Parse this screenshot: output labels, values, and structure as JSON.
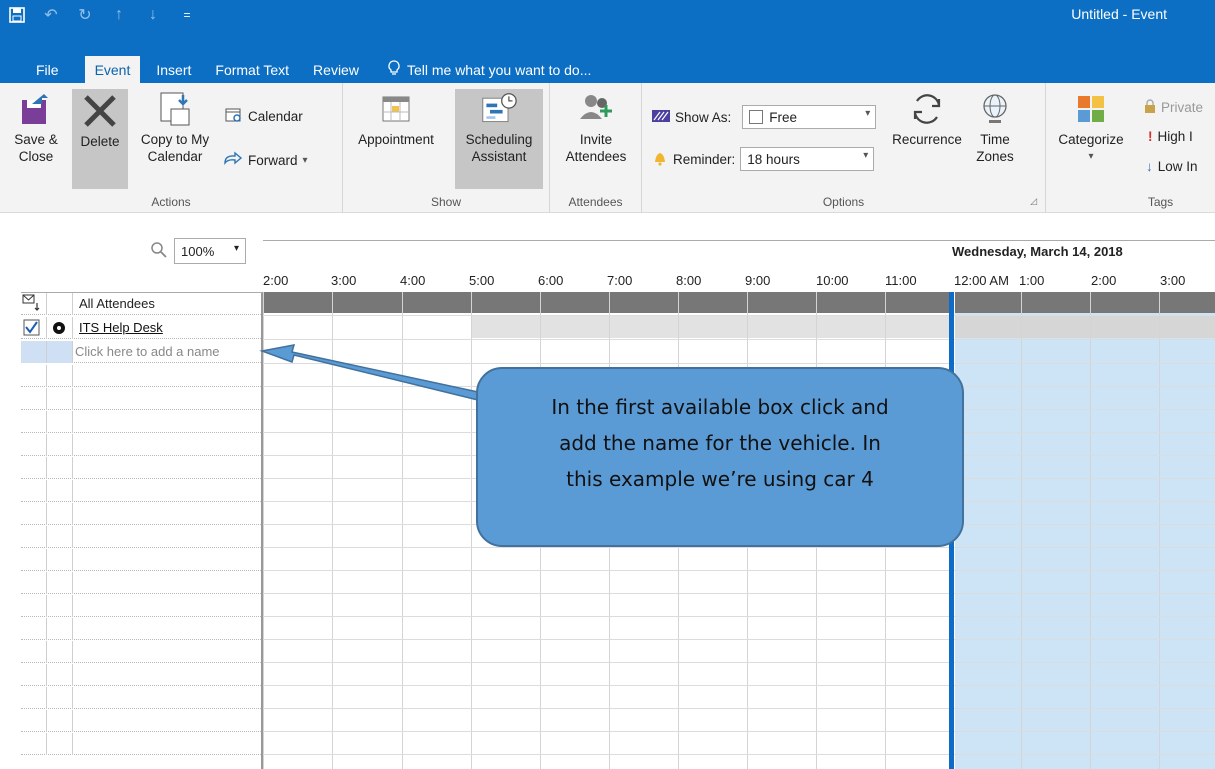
{
  "window": {
    "title": "Untitled - Event"
  },
  "qat": [
    {
      "icon": "save-icon",
      "glyph": "🖫"
    },
    {
      "icon": "undo-icon",
      "glyph": "↶"
    },
    {
      "icon": "redo-icon",
      "glyph": "↻"
    },
    {
      "icon": "up-arrow-icon",
      "glyph": "↑"
    },
    {
      "icon": "down-arrow-icon",
      "glyph": "↓"
    },
    {
      "icon": "customize-qat-icon",
      "glyph": "⩡"
    }
  ],
  "tabs": {
    "file": "File",
    "event": "Event",
    "insert": "Insert",
    "format_text": "Format Text",
    "review": "Review",
    "tell_me": "Tell me what you want to do..."
  },
  "ribbon": {
    "actions": {
      "label": "Actions",
      "save_close_1": "Save &",
      "save_close_2": "Close",
      "delete": "Delete",
      "copy_1": "Copy to My",
      "copy_2": "Calendar",
      "calendar": "Calendar",
      "forward": "Forward"
    },
    "show": {
      "label": "Show",
      "appointment": "Appointment",
      "scheduling_1": "Scheduling",
      "scheduling_2": "Assistant"
    },
    "attendees": {
      "label": "Attendees",
      "invite_1": "Invite",
      "invite_2": "Attendees"
    },
    "options": {
      "label": "Options",
      "show_as_label": "Show As:",
      "show_as_value": "Free",
      "reminder_label": "Reminder:",
      "reminder_value": "18 hours",
      "recurrence": "Recurrence",
      "time_zones_1": "Time",
      "time_zones_2": "Zones"
    },
    "tags": {
      "label": "Tags",
      "categorize": "Categorize",
      "private": "Private",
      "high": "High I",
      "low": "Low In"
    }
  },
  "scheduler": {
    "zoom": "100%",
    "day_title": "Wednesday, March 14, 2018",
    "times": [
      "2:00",
      "3:00",
      "4:00",
      "5:00",
      "6:00",
      "7:00",
      "8:00",
      "9:00",
      "10:00",
      "11:00",
      "12:00 AM",
      "1:00",
      "2:00",
      "3:00"
    ],
    "rows": {
      "all_attendees": "All Attendees",
      "attendee_1": "ITS Help Desk",
      "add_placeholder": "Click here to add a name"
    }
  },
  "callout": {
    "line1": "In the first available box click and",
    "line2": "add the name for the vehicle. In",
    "line3": "this example we’re using car 4"
  },
  "colors": {
    "accent": "#0c6fc4",
    "callout_fill": "#5b9bd5",
    "callout_border": "#41719c",
    "all_attendees_bar": "#777777",
    "selection_blue": "#cde3f6"
  }
}
